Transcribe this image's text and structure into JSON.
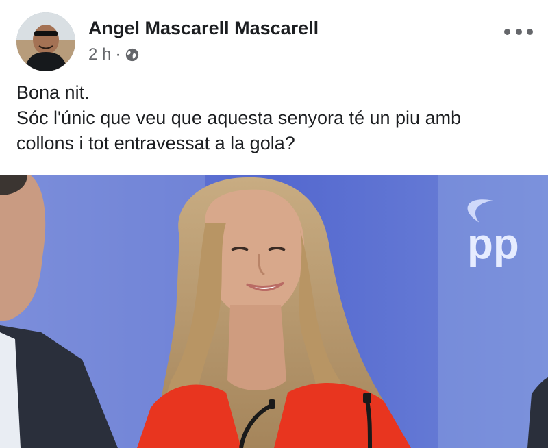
{
  "post": {
    "author_name": "Angel Mascarell Mascarell",
    "timestamp": "2 h",
    "separator": "·",
    "audience_icon": "globe-icon",
    "more_icon": "more-options-icon",
    "text_lines": [
      "Bona nit.",
      "Sóc l'únic que veu que aquesta senyora té un piu amb",
      "collons i tot entravessat a la gola?"
    ],
    "photo_logo_text": "pp"
  },
  "colors": {
    "author_text": "#1c1e21",
    "meta_text": "#65676b",
    "photo_background": "#5f72d6",
    "jacket": "#e8351f"
  }
}
